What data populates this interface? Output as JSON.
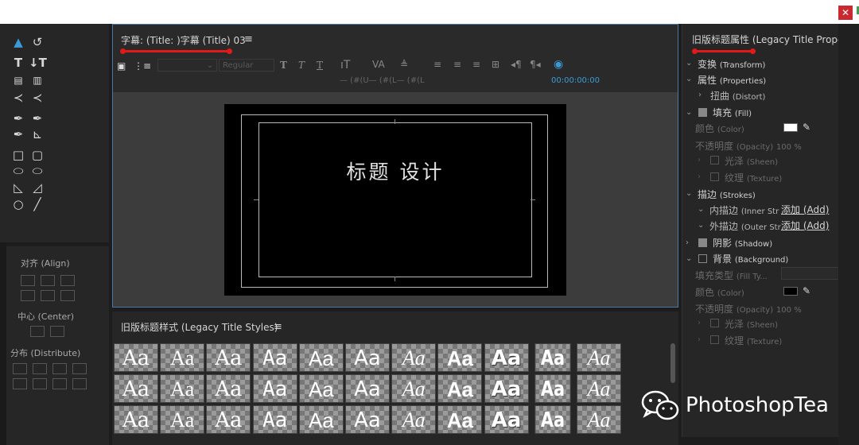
{
  "title_panel": {
    "title": "字幕: (Title: )字幕 (Title) 03",
    "menu_glyph": "≡",
    "font_style": "Regular",
    "path_text": "— (#(U— (#(L— (#(L",
    "timecode": "00:00:00:00",
    "accent_color": "#3a9bd5"
  },
  "canvas": {
    "title_text": "标题 设计"
  },
  "styles_panel": {
    "title": "旧版标题样式 (Legacy Title Styles)",
    "menu_glyph": "≡",
    "sample": "Aa",
    "rows": 3,
    "cols": 11
  },
  "align_panel": {
    "align_label": "对齐 (Align)",
    "center_label": "中心 (Center)",
    "distribute_label": "分布 (Distribute)"
  },
  "properties_panel": {
    "title": "旧版标题属性 (Legacy Title Propert",
    "items": [
      {
        "zh": "变换",
        "en": "(Transform)"
      },
      {
        "zh": "属性",
        "en": "(Properties)"
      },
      {
        "zh": "扭曲",
        "en": "(Distort)"
      },
      {
        "zh": "填充",
        "en": "(Fill)"
      },
      {
        "zh": "颜色",
        "en": "(Color)"
      },
      {
        "zh": "不透明度",
        "en": "(Opacity)",
        "value": "100 %"
      },
      {
        "zh": "光泽",
        "en": "(Sheen)"
      },
      {
        "zh": "纹理",
        "en": "(Texture)"
      },
      {
        "zh": "描边",
        "en": "(Strokes)"
      },
      {
        "zh": "内描边",
        "en": "(Inner Str"
      },
      {
        "zh": "外描边",
        "en": "(Outer Str"
      },
      {
        "zh": "阴影",
        "en": "(Shadow)"
      },
      {
        "zh": "背景",
        "en": "(Background)"
      },
      {
        "zh": "填充类型",
        "en": "(Fill Ty..."
      },
      {
        "zh": "颜色",
        "en": "(Color)"
      },
      {
        "zh": "不透明度",
        "en": "(Opacity)",
        "value": "100 %"
      },
      {
        "zh": "光泽",
        "en": "(Sheen)"
      },
      {
        "zh": "纹理",
        "en": "(Texture)"
      }
    ],
    "add_label": "添加 (Add)",
    "fill_color": "#ffffff",
    "bg_color": "#000000"
  },
  "watermark": {
    "text": "PhotoshopTea"
  },
  "window": {
    "close_glyph": "✕"
  },
  "icons": [
    "selection-arrow-icon",
    "rotate-icon",
    "type-icon",
    "vertical-type-icon",
    "area-type-icon",
    "vertical-area-type-icon",
    "path-type-icon",
    "vertical-path-type-icon",
    "pen-icon",
    "delete-anchor-icon",
    "add-anchor-icon",
    "convert-anchor-icon",
    "rectangle-icon",
    "rounded-rectangle-icon",
    "clipped-rectangle-icon",
    "rounded-corner-rectangle-icon",
    "wedge-icon",
    "arc-icon",
    "ellipse-icon",
    "line-icon"
  ]
}
